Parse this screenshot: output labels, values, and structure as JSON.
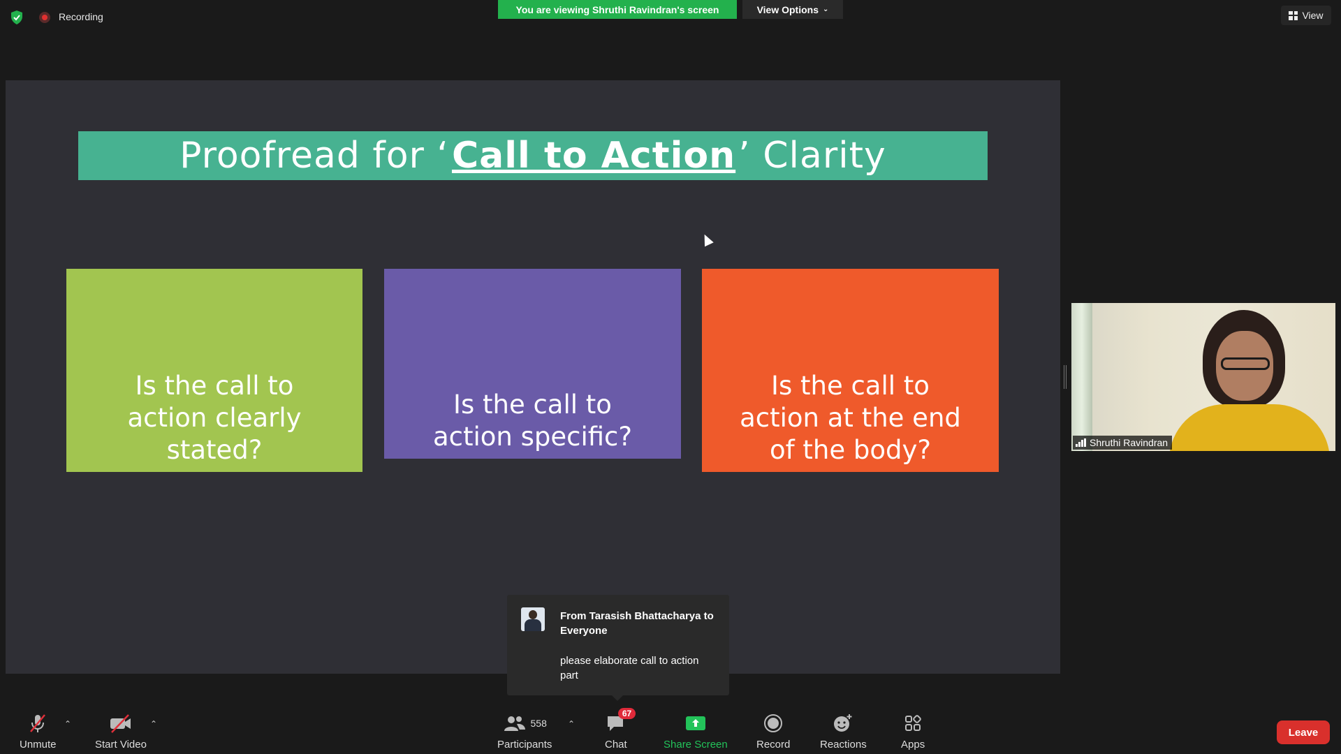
{
  "topbar": {
    "recording_label": "Recording",
    "viewing_banner": "You are viewing Shruthi Ravindran's screen",
    "view_options_label": "View Options",
    "view_label": "View"
  },
  "slide": {
    "title_prefix": "Proofread for ‘",
    "title_emphasis": "Call to Action",
    "title_suffix": "’ Clarity",
    "boxes": [
      "Is the call to action clearly stated?",
      "Is the call to action specific?",
      "Is the call to action at the end of the body?"
    ]
  },
  "chat_popup": {
    "from": "From Tarasish Bhattacharya to Everyone",
    "message": "please elaborate call to action part"
  },
  "speaker": {
    "name": "Shruthi Ravindran"
  },
  "toolbar": {
    "unmute": "Unmute",
    "start_video": "Start Video",
    "participants": "Participants",
    "participants_count": "558",
    "chat": "Chat",
    "chat_badge": "67",
    "share_screen": "Share Screen",
    "record": "Record",
    "reactions": "Reactions",
    "apps": "Apps",
    "leave": "Leave"
  },
  "colors": {
    "banner_green": "#23b14d",
    "title_teal": "#47b291",
    "box_green": "#a2c550",
    "box_purple": "#6a5ba8",
    "box_orange": "#ef5a2b",
    "leave_red": "#d9302c"
  }
}
